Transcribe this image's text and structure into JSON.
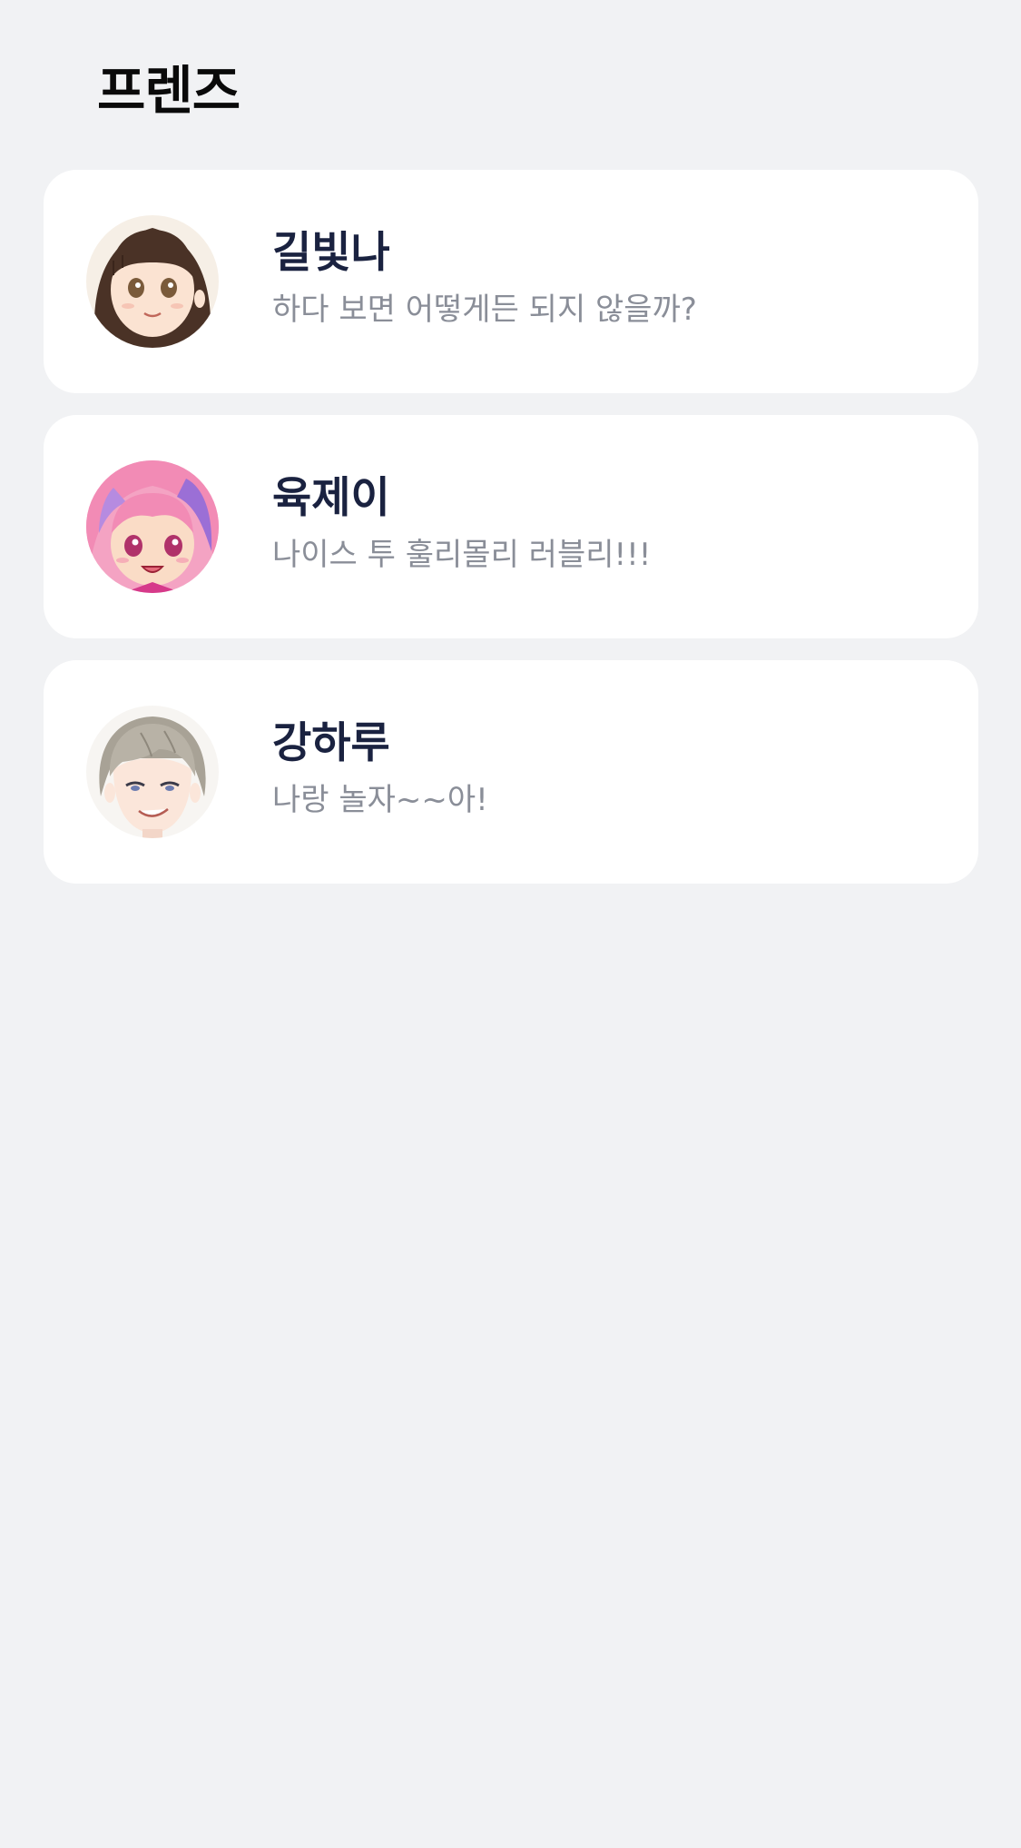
{
  "header": {
    "title": "프렌즈"
  },
  "friends": [
    {
      "name": "길빛나",
      "status": "하다 보면 어떻게든 되지 않을까?",
      "avatar_icon": "avatar-girl-brown-bangs-icon"
    },
    {
      "name": "육제이",
      "status": "나이스 투 훌리몰리 러블리!!!",
      "avatar_icon": "avatar-girl-pink-hair-icon"
    },
    {
      "name": "강하루",
      "status": "나랑 놀자~~아!",
      "avatar_icon": "avatar-boy-gray-hair-icon"
    }
  ],
  "colors": {
    "background": "#f1f2f4",
    "card": "#ffffff",
    "name": "#1a2240",
    "status": "#8a8e98"
  }
}
